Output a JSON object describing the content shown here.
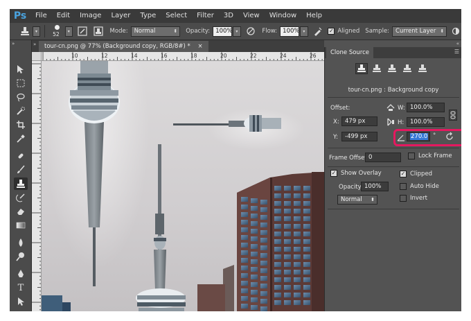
{
  "app": {
    "logo": "Ps",
    "menu": [
      "File",
      "Edit",
      "Image",
      "Layer",
      "Type",
      "Select",
      "Filter",
      "3D",
      "View",
      "Window",
      "Help"
    ]
  },
  "options_bar": {
    "brush_size": "52",
    "mode_label": "Mode:",
    "mode_value": "Normal",
    "opacity_label": "Opacity:",
    "opacity_value": "100%",
    "flow_label": "Flow:",
    "flow_value": "100%",
    "aligned_label": "Aligned",
    "aligned_checked": true,
    "sample_label": "Sample:",
    "sample_value": "Current Layer"
  },
  "document": {
    "tab_title": "tour-cn.png @ 77% (Background copy, RGB/8#) *",
    "close_glyph": "×",
    "ruler_ticks": [
      "10",
      "12",
      "14",
      "16",
      "18",
      "20",
      "22",
      "24",
      "26"
    ]
  },
  "clone_source": {
    "panel_title": "Clone Source",
    "source_name": "tour-cn.png : Background copy",
    "offset_label": "Offset:",
    "x_label": "X:",
    "x_value": "479 px",
    "y_label": "Y:",
    "y_value": "-499 px",
    "w_label": "W:",
    "w_value": "100.0%",
    "h_label": "H:",
    "h_value": "100.0%",
    "angle_value": "270.0",
    "degree_symbol": "°",
    "frame_offset_label": "Frame Offset:",
    "frame_offset_value": "0",
    "lock_frame_label": "Lock Frame",
    "show_overlay_label": "Show Overlay",
    "show_overlay_checked": true,
    "overlay_opacity_label": "Opacity:",
    "overlay_opacity_value": "100%",
    "blend_mode_value": "Normal",
    "clipped_label": "Clipped",
    "clipped_checked": true,
    "auto_hide_label": "Auto Hide",
    "invert_label": "Invert"
  },
  "colors": {
    "menubar": "#3a3a3a",
    "panel": "#535353",
    "highlight": "#e5185f",
    "selection": "#3778d6",
    "logo": "#4aa3df"
  },
  "icons": {
    "tools": [
      "move-icon",
      "marquee-icon",
      "lasso-icon",
      "quick-select-icon",
      "crop-icon",
      "eyedropper-icon",
      "healing-brush-icon",
      "brush-icon",
      "clone-stamp-icon",
      "history-brush-icon",
      "eraser-icon",
      "gradient-icon",
      "blur-icon",
      "dodge-icon",
      "pen-icon",
      "type-icon",
      "path-select-icon",
      "rectangle-icon",
      "hand-icon"
    ]
  }
}
